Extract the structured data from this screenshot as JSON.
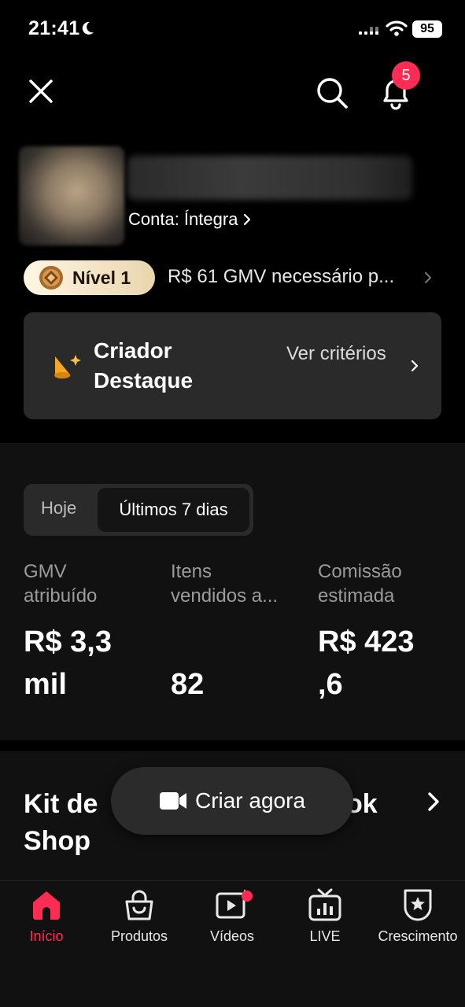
{
  "status_bar": {
    "time": "21:41",
    "battery": "95"
  },
  "notifications": {
    "count": "5"
  },
  "profile": {
    "account_label": "Conta: Íntegra"
  },
  "level": {
    "label": "Nível 1",
    "gmv_text": "R$ 61 GMV necessário p..."
  },
  "creator_card": {
    "title": "Criador Destaque",
    "link": "Ver critérios"
  },
  "stats": {
    "tabs": {
      "today": "Hoje",
      "week": "Últimos 7 dias",
      "selected": "Últimos 7 dias"
    },
    "metrics": [
      {
        "label_1": "GMV",
        "label_2": "atribuído",
        "value_1": "R$ 3,3",
        "value_2": "mil"
      },
      {
        "label_1": "Itens",
        "label_2": "vendidos a...",
        "value_1": "",
        "value_2": "82"
      },
      {
        "label_1": "Comissão",
        "label_2": "estimada",
        "value_1": "R$ 423",
        "value_2": ",6"
      }
    ]
  },
  "kit": {
    "title_start": "Kit de Shop",
    "title_end": "ok"
  },
  "create_button": {
    "label": "Criar agora"
  },
  "tabbar": {
    "items": [
      {
        "label": "Início",
        "icon": "home-icon",
        "active": true
      },
      {
        "label": "Produtos",
        "icon": "shopping-bag-icon"
      },
      {
        "label": "Vídeos",
        "icon": "video-play-icon"
      },
      {
        "label": "LIVE",
        "icon": "live-tv-icon"
      },
      {
        "label": "Crescimento",
        "icon": "star-shield-icon"
      }
    ]
  },
  "colors": {
    "accent": "#fe2c55",
    "card": "#2a2a2a",
    "section": "#111111",
    "gold_start": "#fff6e3",
    "gold_end": "#e9d6ae"
  }
}
